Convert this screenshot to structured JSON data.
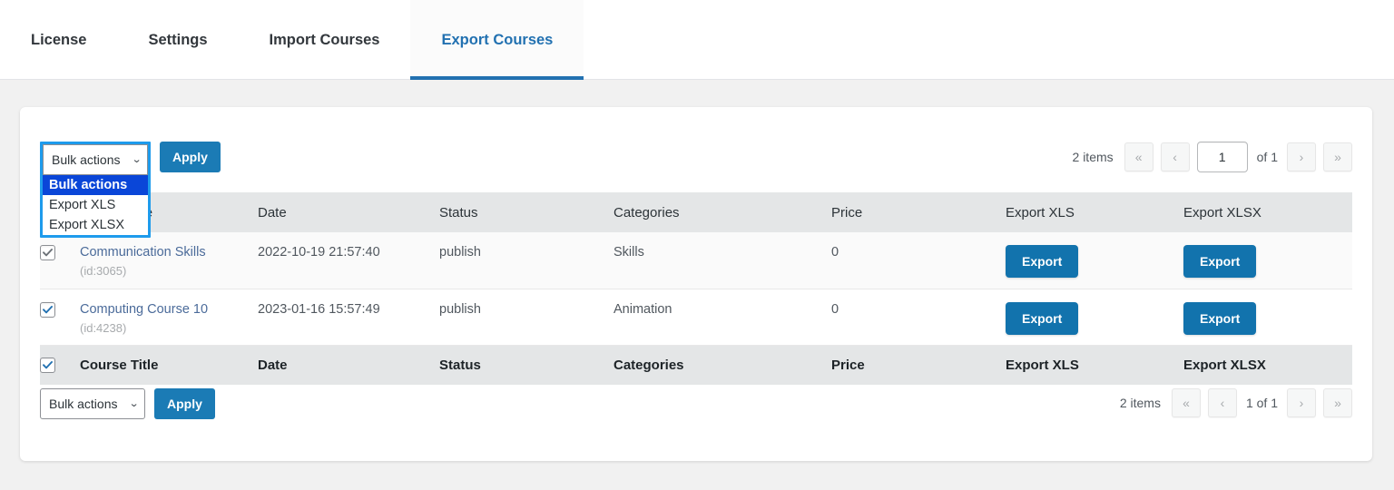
{
  "tabs": [
    {
      "label": "License",
      "active": false
    },
    {
      "label": "Settings",
      "active": false
    },
    {
      "label": "Import Courses",
      "active": false
    },
    {
      "label": "Export Courses",
      "active": true
    }
  ],
  "colors": {
    "accent": "#2271b1",
    "button_primary": "#1273ad",
    "apply_button": "#1b7bb5",
    "focus_ring": "#1e9bec",
    "dropdown_selected": "#0a46d8",
    "header_bg": "#e4e6e7",
    "page_bg": "#f1f1f1",
    "link": "#4b6b9a"
  },
  "bulk_top": {
    "selected_value": "Bulk actions",
    "chevron": "⌄",
    "apply_label": "Apply",
    "open": true,
    "options": [
      {
        "label": "Bulk actions",
        "selected": true
      },
      {
        "label": "Export XLS",
        "selected": false
      },
      {
        "label": "Export XLSX",
        "selected": false
      }
    ]
  },
  "bulk_bottom": {
    "selected_value": "Bulk actions",
    "chevron": "⌄",
    "apply_label": "Apply",
    "open": false
  },
  "pagination_top": {
    "items_text": "2 items",
    "first_label": "«",
    "prev_label": "‹",
    "current_page": "1",
    "of_text": "of 1",
    "next_label": "›",
    "last_label": "»"
  },
  "pagination_bottom": {
    "items_text": "2 items",
    "first_label": "«",
    "prev_label": "‹",
    "page_of_text": "1 of 1",
    "next_label": "›",
    "last_label": "»"
  },
  "table": {
    "columns": [
      {
        "key": "title",
        "label": "Course Title"
      },
      {
        "key": "date",
        "label": "Date"
      },
      {
        "key": "status",
        "label": "Status"
      },
      {
        "key": "cat",
        "label": "Categories"
      },
      {
        "key": "price",
        "label": "Price"
      },
      {
        "key": "xls",
        "label": "Export XLS"
      },
      {
        "key": "xlsx",
        "label": "Export XLSX"
      }
    ],
    "export_label": "Export",
    "rows": [
      {
        "checked": true,
        "title": "Communication Skills",
        "id": "(id:3065)",
        "date": "2022-10-19 21:57:40",
        "status": "publish",
        "categories": "Skills",
        "price": "0",
        "xls_label": "Export",
        "xlsx_label": "Export"
      },
      {
        "checked": true,
        "title": "Computing Course 10",
        "id": "(id:4238)",
        "date": "2023-01-16 15:57:49",
        "status": "publish",
        "categories": "Animation",
        "price": "0",
        "xls_label": "Export",
        "xlsx_label": "Export"
      }
    ]
  }
}
